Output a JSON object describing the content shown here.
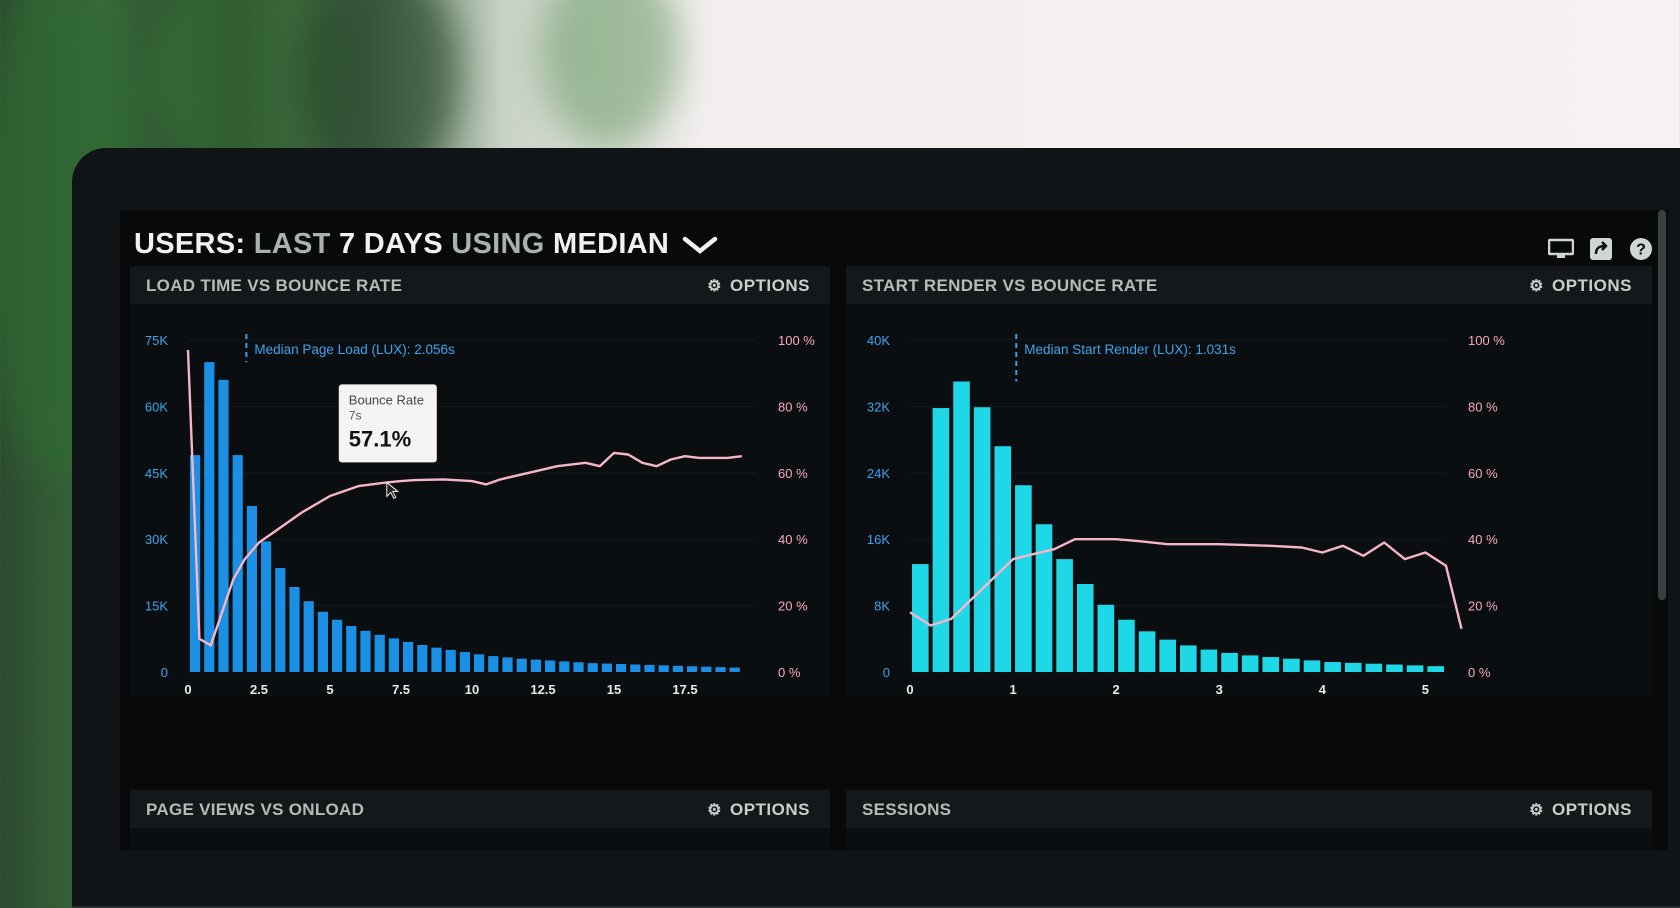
{
  "header": {
    "users_label": "USERS:",
    "last_label": "LAST",
    "days_label": "7 DAYS",
    "using_label": "USING",
    "median_label": "MEDIAN",
    "icons": [
      "monitor-icon",
      "share-icon",
      "help-icon"
    ]
  },
  "panels": [
    {
      "title": "LOAD TIME VS BOUNCE RATE",
      "options": "OPTIONS"
    },
    {
      "title": "START RENDER VS BOUNCE RATE",
      "options": "OPTIONS"
    },
    {
      "title": "PAGE VIEWS VS ONLOAD",
      "options": "OPTIONS"
    },
    {
      "title": "SESSIONS",
      "options": "OPTIONS"
    }
  ],
  "tooltip": {
    "title": "Bounce Rate",
    "x": "7s",
    "value": "57.1%"
  },
  "colors": {
    "bar_left": "#1a8fe3",
    "bar_right": "#1ed8e8",
    "line": "#f7b6c8",
    "median": "#3aa0e8",
    "accent_text": "#3aa6ee"
  },
  "chart_data": [
    {
      "type": "bar",
      "title": "LOAD TIME VS BOUNCE RATE",
      "xlim": [
        0,
        20
      ],
      "xticks": [
        0,
        2.5,
        5,
        7.5,
        10,
        12.5,
        15,
        17.5
      ],
      "xtick_labels": [
        "0",
        "2.5",
        "5",
        "7.5",
        "10",
        "12.5",
        "15",
        "17.5"
      ],
      "ylim": [
        0,
        75000
      ],
      "yticks": [
        0,
        15000,
        30000,
        45000,
        60000,
        75000
      ],
      "ytick_labels": [
        "0",
        "15K",
        "30K",
        "45K",
        "60K",
        "75K"
      ],
      "y2lim": [
        0,
        100
      ],
      "y2ticks": [
        0,
        20,
        40,
        60,
        80,
        100
      ],
      "y2tick_labels": [
        "0 %",
        "20 %",
        "40 %",
        "60 %",
        "80 %",
        "100 %"
      ],
      "median": {
        "x": 2.056,
        "label": "Median Page Load (LUX): 2.056s"
      },
      "series": [
        {
          "name": "Page Load (LUX)",
          "kind": "bar",
          "bin_width": 0.5,
          "x": [
            0,
            0.5,
            1,
            1.5,
            2,
            2.5,
            3,
            3.5,
            4,
            4.5,
            5,
            5.5,
            6,
            6.5,
            7,
            7.5,
            8,
            8.5,
            9,
            9.5,
            10,
            10.5,
            11,
            11.5,
            12,
            12.5,
            13,
            13.5,
            14,
            14.5,
            15,
            15.5,
            16,
            16.5,
            17,
            17.5,
            18,
            18.5,
            19
          ],
          "values": [
            49000,
            70000,
            66000,
            49000,
            37500,
            29500,
            23500,
            19200,
            16000,
            13600,
            11800,
            10400,
            9300,
            8400,
            7600,
            6800,
            6100,
            5500,
            5000,
            4500,
            4000,
            3600,
            3300,
            3000,
            2800,
            2600,
            2400,
            2200,
            2000,
            1900,
            1800,
            1700,
            1600,
            1500,
            1400,
            1300,
            1200,
            1100,
            1000
          ]
        },
        {
          "name": "Bounce Rate",
          "kind": "line",
          "axis": "right",
          "x": [
            0,
            0.4,
            0.8,
            1.2,
            1.6,
            2,
            2.5,
            3,
            3.5,
            4,
            5,
            6,
            7,
            7.5,
            8,
            9,
            10,
            10.5,
            11,
            12,
            13,
            14,
            14.5,
            15,
            15.5,
            16,
            16.5,
            17,
            17.5,
            18,
            19,
            19.5
          ],
          "values": [
            97,
            10,
            8,
            18,
            28,
            34,
            39,
            42,
            45,
            48,
            53,
            56,
            57.1,
            57.5,
            57.8,
            58,
            57.5,
            56.5,
            58,
            60,
            62,
            63,
            62,
            66,
            65.5,
            63,
            62,
            64,
            65,
            64.5,
            64.5,
            65
          ]
        }
      ]
    },
    {
      "type": "bar",
      "title": "START RENDER VS BOUNCE RATE",
      "xlim": [
        0,
        5.2
      ],
      "xticks": [
        0,
        1,
        2,
        3,
        4,
        5
      ],
      "xtick_labels": [
        "0",
        "1",
        "2",
        "3",
        "4",
        "5"
      ],
      "ylim": [
        0,
        40000
      ],
      "yticks": [
        0,
        8000,
        16000,
        24000,
        32000,
        40000
      ],
      "ytick_labels": [
        "0",
        "8K",
        "16K",
        "24K",
        "32K",
        "40K"
      ],
      "y2lim": [
        0,
        100
      ],
      "y2ticks": [
        0,
        20,
        40,
        60,
        80,
        100
      ],
      "y2tick_labels": [
        "0 %",
        "20 %",
        "40 %",
        "60 %",
        "80 %",
        "100 %"
      ],
      "median": {
        "x": 1.031,
        "label": "Median Start Render (LUX): 1.031s"
      },
      "series": [
        {
          "name": "Start Render (LUX)",
          "kind": "bar",
          "bin_width": 0.2,
          "x": [
            0.1,
            0.3,
            0.5,
            0.7,
            0.9,
            1.1,
            1.3,
            1.5,
            1.7,
            1.9,
            2.1,
            2.3,
            2.5,
            2.7,
            2.9,
            3.1,
            3.3,
            3.5,
            3.7,
            3.9,
            4.1,
            4.3,
            4.5,
            4.7,
            4.9,
            5.1
          ],
          "values": [
            13000,
            31800,
            35000,
            31900,
            27200,
            22500,
            17800,
            13600,
            10600,
            8100,
            6300,
            4900,
            3900,
            3200,
            2700,
            2300,
            2000,
            1800,
            1600,
            1400,
            1200,
            1100,
            1000,
            900,
            800,
            700
          ]
        },
        {
          "name": "Bounce Rate",
          "kind": "line",
          "axis": "right",
          "x": [
            0,
            0.2,
            0.4,
            0.6,
            0.8,
            1,
            1.2,
            1.4,
            1.6,
            1.8,
            2,
            2.2,
            2.5,
            3,
            3.5,
            3.8,
            4,
            4.2,
            4.4,
            4.6,
            4.8,
            5,
            5.2,
            5.35
          ],
          "values": [
            18,
            14,
            16,
            22,
            28,
            34,
            35.5,
            37,
            40,
            40,
            40,
            39.5,
            38.5,
            38.5,
            38,
            37.5,
            36,
            38,
            35,
            39,
            34,
            36,
            32,
            13
          ]
        }
      ]
    }
  ]
}
